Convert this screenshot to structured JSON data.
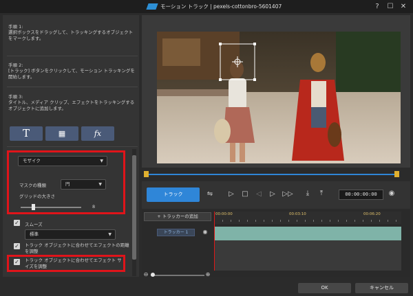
{
  "window": {
    "title": "モーション トラック | pexels-cottonbro-5601407",
    "help_label": "?",
    "maximize_label": "☐",
    "close_label": "✕"
  },
  "steps": [
    {
      "title": "手順 1:",
      "desc": "選択ボックスをドラッグして、トラッキングするオブジェクトをマークします。"
    },
    {
      "title": "手順 2:",
      "desc": "[トラック] ボタンをクリックして、モーション トラッキングを開始します。"
    },
    {
      "title": "手順 3:",
      "desc": "タイトル、メディア クリップ、エフェクトをトラッキングするオブジェクトに追加します。"
    }
  ],
  "effect_buttons": {
    "title": "T",
    "media": "▦",
    "fx": "fx"
  },
  "effect": {
    "dropdown_value": "モザイク",
    "mask_type_label": "マスクの種類",
    "mask_type_value": "円",
    "grid_size_label": "グリッドの大きさ",
    "grid_size_value": "8",
    "grid_size_fraction": 0.2
  },
  "smooth": {
    "label": "スムーズ",
    "checked": true,
    "dropdown_value": "標準"
  },
  "options": {
    "distance_label": "トラック オブジェクトに合わせてエフェクトの距離を調整",
    "size_label": "トラック オブジェクトに合わせてエフェクト サイズを調整"
  },
  "playback": {
    "track_button": "トラック",
    "timecode": "00:00:00:00",
    "progress_fraction": 0.0
  },
  "timeline": {
    "add_tracker_label": "トラッカーの追加",
    "add_icon": "+",
    "ticks": [
      "00:00:00",
      "00:03:10",
      "00:06:20"
    ],
    "tracker_name": "トラッカー 1"
  },
  "footer": {
    "ok_label": "OK",
    "cancel_label": "キャンセル"
  },
  "colors": {
    "accent": "#2f86d8",
    "highlight": "#e0141a",
    "clip": "#7fb3a8"
  }
}
